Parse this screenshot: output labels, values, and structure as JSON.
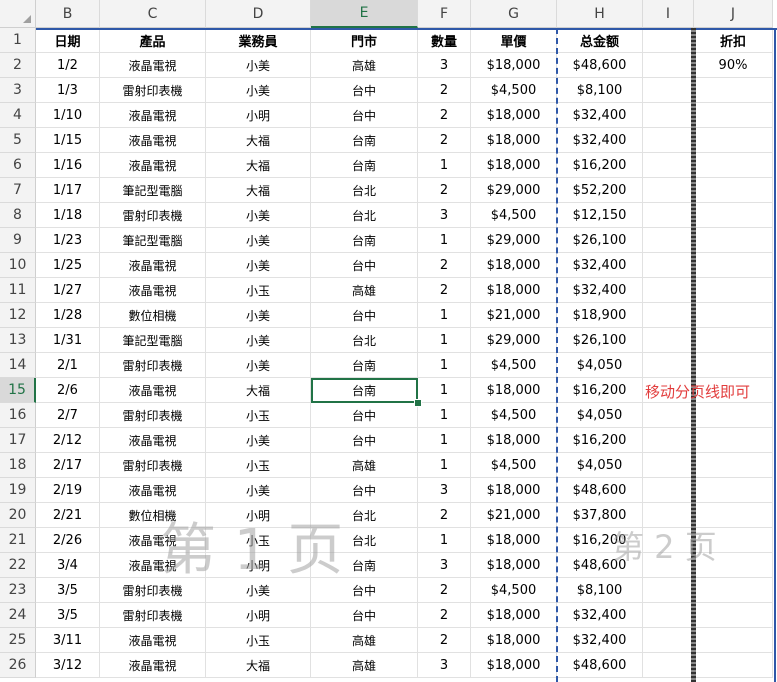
{
  "columns": [
    "B",
    "C",
    "D",
    "E",
    "F",
    "G",
    "H",
    "I",
    "J"
  ],
  "selected_column": "E",
  "row_numbers": [
    "1",
    "2",
    "3",
    "4",
    "5",
    "6",
    "7",
    "8",
    "9",
    "10",
    "11",
    "12",
    "13",
    "14",
    "15",
    "16",
    "17",
    "18",
    "19",
    "20",
    "21",
    "22",
    "23",
    "24",
    "25",
    "26"
  ],
  "selected_row": "15",
  "headers": {
    "date": "日期",
    "product": "產品",
    "salesperson": "業務員",
    "store": "門市",
    "qty": "數量",
    "price": "單價",
    "total": "总金额",
    "discount": "折扣"
  },
  "discount_value": "90%",
  "rows": [
    [
      "1/2",
      "液晶電視",
      "小美",
      "高雄",
      "3",
      "$18,000",
      "$48,600"
    ],
    [
      "1/3",
      "雷射印表機",
      "小美",
      "台中",
      "2",
      "$4,500",
      "$8,100"
    ],
    [
      "1/10",
      "液晶電視",
      "小明",
      "台中",
      "2",
      "$18,000",
      "$32,400"
    ],
    [
      "1/15",
      "液晶電視",
      "大福",
      "台南",
      "2",
      "$18,000",
      "$32,400"
    ],
    [
      "1/16",
      "液晶電視",
      "大福",
      "台南",
      "1",
      "$18,000",
      "$16,200"
    ],
    [
      "1/17",
      "筆記型電腦",
      "大福",
      "台北",
      "2",
      "$29,000",
      "$52,200"
    ],
    [
      "1/18",
      "雷射印表機",
      "小美",
      "台北",
      "3",
      "$4,500",
      "$12,150"
    ],
    [
      "1/23",
      "筆記型電腦",
      "小美",
      "台南",
      "1",
      "$29,000",
      "$26,100"
    ],
    [
      "1/25",
      "液晶電視",
      "小美",
      "台中",
      "2",
      "$18,000",
      "$32,400"
    ],
    [
      "1/27",
      "液晶電視",
      "小玉",
      "高雄",
      "2",
      "$18,000",
      "$32,400"
    ],
    [
      "1/28",
      "數位相機",
      "小美",
      "台中",
      "1",
      "$21,000",
      "$18,900"
    ],
    [
      "1/31",
      "筆記型電腦",
      "小美",
      "台北",
      "1",
      "$29,000",
      "$26,100"
    ],
    [
      "2/1",
      "雷射印表機",
      "小美",
      "台南",
      "1",
      "$4,500",
      "$4,050"
    ],
    [
      "2/6",
      "液晶電視",
      "大福",
      "台南",
      "1",
      "$18,000",
      "$16,200"
    ],
    [
      "2/7",
      "雷射印表機",
      "小玉",
      "台中",
      "1",
      "$4,500",
      "$4,050"
    ],
    [
      "2/12",
      "液晶電視",
      "小美",
      "台中",
      "1",
      "$18,000",
      "$16,200"
    ],
    [
      "2/17",
      "雷射印表機",
      "小玉",
      "高雄",
      "1",
      "$4,500",
      "$4,050"
    ],
    [
      "2/19",
      "液晶電視",
      "小美",
      "台中",
      "3",
      "$18,000",
      "$48,600"
    ],
    [
      "2/21",
      "數位相機",
      "小明",
      "台北",
      "2",
      "$21,000",
      "$37,800"
    ],
    [
      "2/26",
      "液晶電視",
      "小玉",
      "台北",
      "1",
      "$18,000",
      "$16,200"
    ],
    [
      "3/4",
      "液晶電視",
      "小明",
      "台南",
      "3",
      "$18,000",
      "$48,600"
    ],
    [
      "3/5",
      "雷射印表機",
      "小美",
      "台中",
      "2",
      "$4,500",
      "$8,100"
    ],
    [
      "3/5",
      "雷射印表機",
      "小明",
      "台中",
      "2",
      "$18,000",
      "$32,400"
    ],
    [
      "3/11",
      "液晶電視",
      "小玉",
      "高雄",
      "2",
      "$18,000",
      "$32,400"
    ],
    [
      "3/12",
      "液晶電視",
      "大福",
      "高雄",
      "3",
      "$18,000",
      "$48,600"
    ]
  ],
  "annotation": "移动分页线即可",
  "watermark_page1": "第 1 页",
  "watermark_page2": "第 2 页",
  "colors": {
    "accent": "#217346",
    "page_break": "#2f58a8",
    "note": "#e23d3d"
  }
}
